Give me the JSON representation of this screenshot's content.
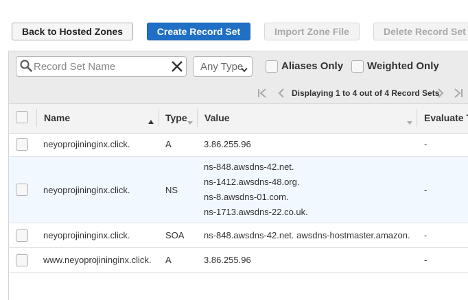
{
  "toolbar": {
    "back_label": "Back to Hosted Zones",
    "create_label": "Create Record Set",
    "import_label": "Import Zone File",
    "delete_label": "Delete Record Set"
  },
  "filters": {
    "search_placeholder": "Record Set Name",
    "search_value": "",
    "type_selected": "Any Type",
    "aliases_label": "Aliases Only",
    "weighted_label": "Weighted Only"
  },
  "pagination": {
    "text": "Displaying 1 to 4 out of 4 Record Sets"
  },
  "table": {
    "columns": [
      "Name",
      "Type",
      "Value",
      "Evaluate T"
    ],
    "rows": [
      {
        "name": "neyoprojininginx.click.",
        "type": "A",
        "values": [
          "3.86.255.96"
        ],
        "evaluate": "-"
      },
      {
        "name": "neyoprojininginx.click.",
        "type": "NS",
        "values": [
          "ns-848.awsdns-42.net.",
          "ns-1412.awsdns-48.org.",
          "ns-8.awsdns-01.com.",
          "ns-1713.awsdns-22.co.uk."
        ],
        "evaluate": "-"
      },
      {
        "name": "neyoprojininginx.click.",
        "type": "SOA",
        "values": [
          "ns-848.awsdns-42.net. awsdns-hostmaster.amazon."
        ],
        "evaluate": "-"
      },
      {
        "name": "www.neyoprojininginx.click.",
        "type": "A",
        "values": [
          "3.86.255.96"
        ],
        "evaluate": "-"
      }
    ]
  },
  "colors": {
    "primary_button": "#1f6fc5",
    "selected_row": "#f1f8ff"
  },
  "icons": [
    "search-icon",
    "clear-icon",
    "chevron-down-icon",
    "first-page-icon",
    "prev-page-icon",
    "next-page-icon",
    "last-page-icon",
    "sort-asc-icon",
    "sort-desc-icon"
  ]
}
